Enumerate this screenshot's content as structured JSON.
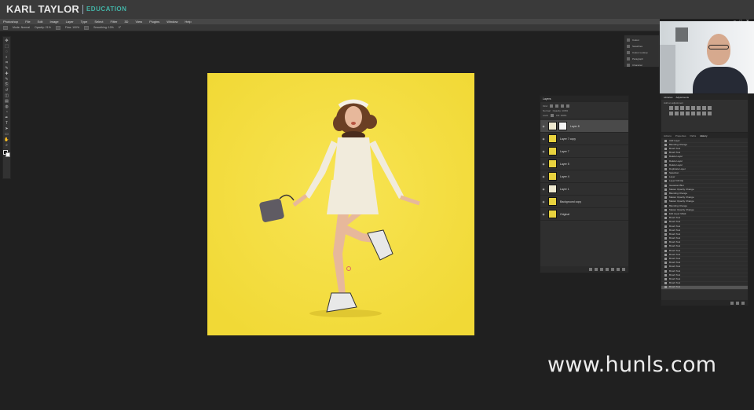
{
  "brand": {
    "main": "KARL TAYLOR",
    "sub": "EDUCATION"
  },
  "menubar": {
    "items": [
      "Photoshop",
      "File",
      "Edit",
      "Image",
      "Layer",
      "Type",
      "Select",
      "Filter",
      "3D",
      "View",
      "Plugins",
      "Window",
      "Help"
    ],
    "controls": [
      "–",
      "□",
      "✕"
    ]
  },
  "options": [
    "Mode: Normal",
    "Opacity: 21%",
    "Flow: 100%",
    "Smoothing: 10%",
    "0°"
  ],
  "tools": [
    "move-icon",
    "marquee-icon",
    "lasso-icon",
    "quick-select-icon",
    "crop-icon",
    "eyedropper-icon",
    "healing-icon",
    "brush-icon",
    "clone-stamp-icon",
    "history-brush-icon",
    "eraser-icon",
    "gradient-icon",
    "blur-icon",
    "dodge-icon",
    "pen-icon",
    "type-icon",
    "path-select-icon",
    "shape-icon",
    "hand-icon",
    "zoom-icon"
  ],
  "tool_glyphs": [
    "✥",
    "⬚",
    "◌",
    "◐",
    "⌗",
    "✎",
    "✚",
    "✎",
    "⎘",
    "↺",
    "◫",
    "▤",
    "◍",
    "◔",
    "✒",
    "T",
    "➤",
    "▭",
    "✋",
    "⌕"
  ],
  "mini_panel": [
    "Colour",
    "Swatches",
    "Colour Lookup",
    "Paragraph",
    "Character"
  ],
  "layers_panel": {
    "tabs": [
      "Layers"
    ],
    "row1": [
      "Kind"
    ],
    "row2": [
      "Normal",
      "Opacity: 100%"
    ],
    "row3": [
      "Lock:",
      "Fill: 100%"
    ],
    "layers": [
      {
        "name": "Layer 8",
        "selected": true,
        "mask": true,
        "light": true
      },
      {
        "name": "Layer 7 copy",
        "selected": false,
        "mask": false,
        "light": false
      },
      {
        "name": "Layer 7",
        "selected": false,
        "mask": false,
        "light": false
      },
      {
        "name": "Layer 5",
        "selected": false,
        "mask": false,
        "light": false
      },
      {
        "name": "Layer 4",
        "selected": false,
        "mask": false,
        "light": false
      },
      {
        "name": "Layer 1",
        "selected": false,
        "mask": false,
        "light": true
      },
      {
        "name": "Background copy",
        "selected": false,
        "mask": false,
        "light": false
      },
      {
        "name": "Original",
        "selected": false,
        "mask": false,
        "light": false
      }
    ]
  },
  "adjust_panel": {
    "tabs": [
      "Libraries",
      "Adjustments"
    ],
    "hint": "Add an adjustment"
  },
  "history_panel": {
    "tabs": [
      "Actions",
      "Properties",
      "Paths",
      "History"
    ],
    "items": [
      "Add Layer",
      "Blending Change",
      "Brush Tool",
      "Brush Tool",
      "Delete Layer",
      "Delete Layer",
      "Delete Layer",
      "Duplicate Layer",
      "Selection",
      "Layer",
      "Layer Fill Clip",
      "Gaussian Blur",
      "Master Opacity Change",
      "Blending Change",
      "Master Opacity Change",
      "Master Opacity Change",
      "Blending Change",
      "Master Opacity Change",
      "Edit Layer Mask",
      "Brush Tool",
      "Brush Tool",
      "Brush Tool",
      "Brush Tool",
      "Brush Tool",
      "Brush Tool",
      "Brush Tool",
      "Brush Tool",
      "Brush Tool",
      "Brush Tool",
      "Brush Tool",
      "Brush Tool",
      "Brush Tool",
      "Brush Tool",
      "Brush Tool",
      "Brush Tool",
      "Brush Tool",
      "Brush Tool"
    ]
  },
  "watermark": "www.hunls.com",
  "colors": {
    "canvas_yellow": "#f6e046",
    "accent_teal": "#43b3a6"
  }
}
